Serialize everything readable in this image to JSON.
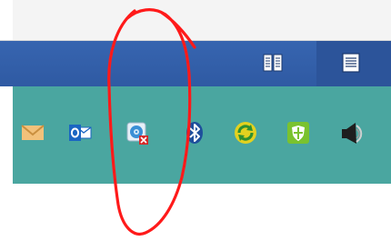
{
  "title_bar": {
    "buttons": [
      {
        "name": "reading-view-icon"
      },
      {
        "name": "print-layout-icon"
      }
    ]
  },
  "tray": {
    "icons": [
      {
        "name": "mail-icon"
      },
      {
        "name": "outlook-icon"
      },
      {
        "name": "disc-tray-icon",
        "badge": "x"
      },
      {
        "name": "bluetooth-icon"
      },
      {
        "name": "sync-icon"
      },
      {
        "name": "shield-icon"
      },
      {
        "name": "speaker-icon"
      }
    ]
  },
  "colors": {
    "title_bar": "#3765b0",
    "tray": "#4aa6a0",
    "annotation": "#ff1a1a"
  }
}
